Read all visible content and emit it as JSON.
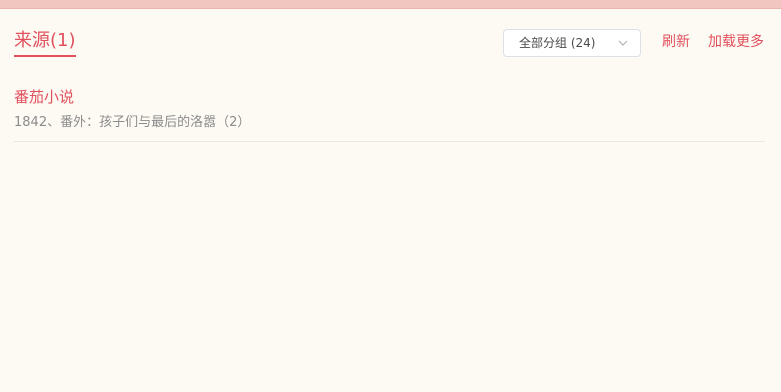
{
  "header": {
    "title": "来源(1)",
    "group_select": {
      "selected": "全部分组 (24)"
    },
    "refresh_label": "刷新",
    "load_more_label": "加载更多"
  },
  "sources": [
    {
      "name": "番茄小说",
      "latest_chapter": "1842、番外：孩子们与最后的洛嚣（2）"
    }
  ],
  "colors": {
    "accent": "#e2505e",
    "background": "#fcfaf3",
    "top_strip": "#f2c6c0",
    "muted_text": "#8c8c8c"
  },
  "icons": {
    "select_arrow": "chevron-down-icon"
  }
}
